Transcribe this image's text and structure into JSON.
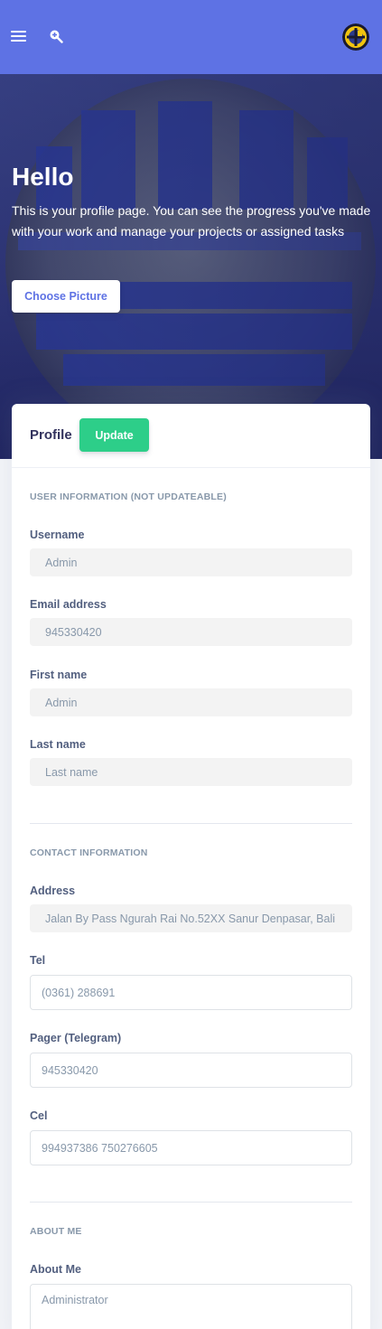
{
  "topbar": {
    "menu_icon": "hamburger-menu-icon",
    "zoom_icon": "zoom-in-icon",
    "avatar_icon": "logo-avatar"
  },
  "hero": {
    "title": "Hello",
    "description": "This is your profile page. You can see the progress you've made with your work and manage your projects or assigned tasks",
    "choose_picture_label": "Choose Picture"
  },
  "card": {
    "title": "Profile",
    "update_label": "Update"
  },
  "user_information": {
    "heading": "USER INFORMATION (Not Updateable)",
    "username": {
      "label": "Username",
      "value": "Admin"
    },
    "email": {
      "label": "Email address",
      "value": "945330420"
    },
    "first_name": {
      "label": "First name",
      "value": "Admin"
    },
    "last_name": {
      "label": "Last name",
      "value": "",
      "placeholder": "Last name"
    }
  },
  "contact_information": {
    "heading": "CONTACT INFORMATION",
    "address": {
      "label": "Address",
      "value": "Jalan By Pass Ngurah Rai No.52XX Sanur Denpasar, Bali"
    },
    "tel": {
      "label": "Tel",
      "value": "(0361) 288691"
    },
    "pager": {
      "label": "Pager (Telegram)",
      "value": "945330420"
    },
    "cel": {
      "label": "Cel",
      "value": "994937386 750276605"
    }
  },
  "about": {
    "heading": "ABOUT ME",
    "about_me": {
      "label": "About Me",
      "value": "Administrator"
    }
  },
  "colors": {
    "primary": "#5e72e4",
    "success": "#2dce89",
    "hero_dark": "#2e3577"
  }
}
